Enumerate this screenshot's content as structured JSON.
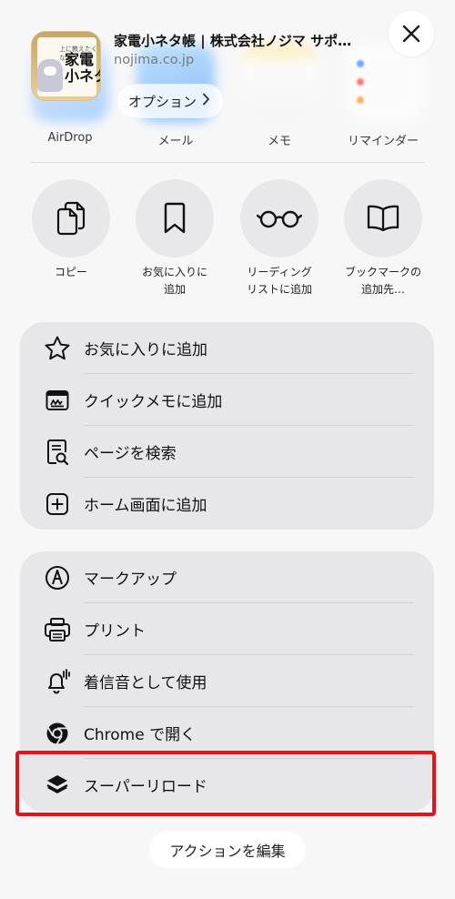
{
  "header": {
    "title": "家電小ネタ帳 | 株式会社ノジマ サポ…",
    "url": "nojima.co.jp",
    "options_label": "オプション",
    "thumbnail_top_text": "上に教えたくなる",
    "thumbnail_big_text": "家電\n小ネタ"
  },
  "apps": [
    {
      "label": "AirDrop",
      "icon": "airdrop-icon"
    },
    {
      "label": "メール",
      "icon": "mail-icon"
    },
    {
      "label": "メモ",
      "icon": "notes-icon"
    },
    {
      "label": "リマインダー",
      "icon": "reminders-icon"
    }
  ],
  "circle_actions": [
    {
      "label": "コピー",
      "icon": "copy-icon"
    },
    {
      "label": "お気に入りに\n追加",
      "icon": "bookmark-icon"
    },
    {
      "label": "リーディング\nリストに追加",
      "icon": "glasses-icon"
    },
    {
      "label": "ブックマークの\n追加先…",
      "icon": "book-icon"
    }
  ],
  "group1": [
    {
      "label": "お気に入りに追加",
      "icon": "star-icon"
    },
    {
      "label": "クイックメモに追加",
      "icon": "quick-note-icon"
    },
    {
      "label": "ページを検索",
      "icon": "find-page-icon"
    },
    {
      "label": "ホーム画面に追加",
      "icon": "add-square-icon"
    }
  ],
  "group2": [
    {
      "label": "マークアップ",
      "icon": "markup-icon"
    },
    {
      "label": "プリント",
      "icon": "printer-icon"
    },
    {
      "label": "着信音として使用",
      "icon": "bell-icon"
    },
    {
      "label": "Chrome で開く",
      "icon": "chrome-icon"
    },
    {
      "label": "スーパーリロード",
      "icon": "layers-icon"
    }
  ],
  "edit_actions_label": "アクションを編集",
  "colors": {
    "highlight": "#e4141b",
    "group_bg": "#e7e7e9",
    "sheet_bg": "#f7f7f8"
  }
}
